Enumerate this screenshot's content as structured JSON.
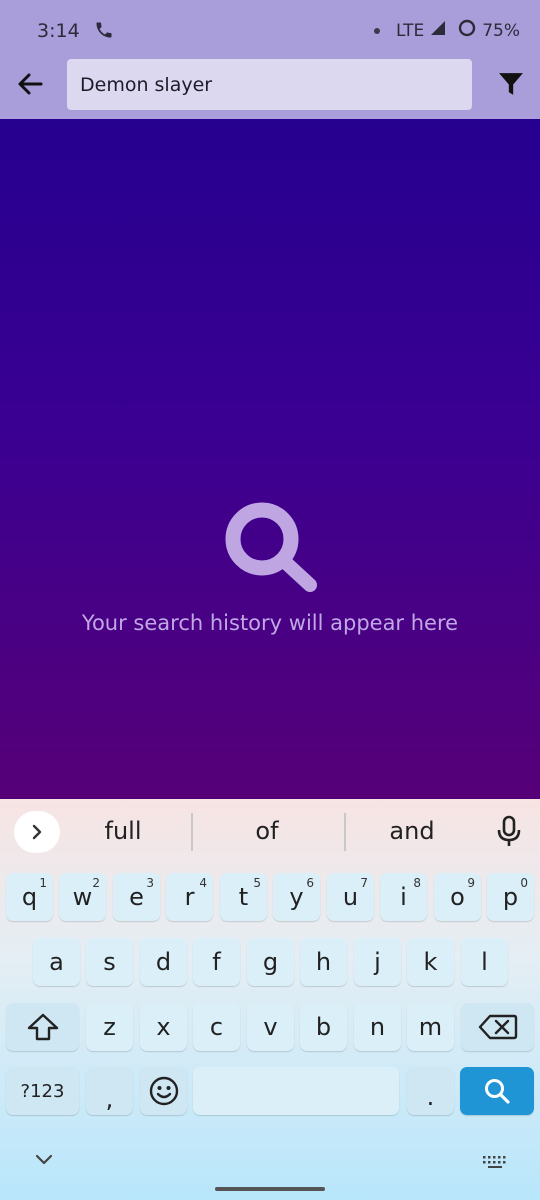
{
  "status_bar": {
    "time": "3:14",
    "network": "LTE",
    "battery": "75%"
  },
  "app_bar": {
    "search_value": "Demon slayer",
    "back_icon": "arrow-left-icon",
    "filter_icon": "filter-icon"
  },
  "empty_state": {
    "icon": "search-icon",
    "message": "Your search history will appear here"
  },
  "keyboard": {
    "suggestions": [
      "full",
      "of",
      "and"
    ],
    "row1": [
      {
        "k": "q",
        "s": "1"
      },
      {
        "k": "w",
        "s": "2"
      },
      {
        "k": "e",
        "s": "3"
      },
      {
        "k": "r",
        "s": "4"
      },
      {
        "k": "t",
        "s": "5"
      },
      {
        "k": "y",
        "s": "6"
      },
      {
        "k": "u",
        "s": "7"
      },
      {
        "k": "i",
        "s": "8"
      },
      {
        "k": "o",
        "s": "9"
      },
      {
        "k": "p",
        "s": "0"
      }
    ],
    "row2": [
      "a",
      "s",
      "d",
      "f",
      "g",
      "h",
      "j",
      "k",
      "l"
    ],
    "row3": [
      "z",
      "x",
      "c",
      "v",
      "b",
      "n",
      "m"
    ],
    "symbols_label": "?123",
    "comma": ",",
    "period": "."
  },
  "colors": {
    "app_bar": "#a99ed9",
    "search_field": "#dcd8f0",
    "content_top": "#26008f",
    "content_bottom": "#560077",
    "empty_text": "#c0a8e6",
    "enter_key": "#1f95d6"
  }
}
